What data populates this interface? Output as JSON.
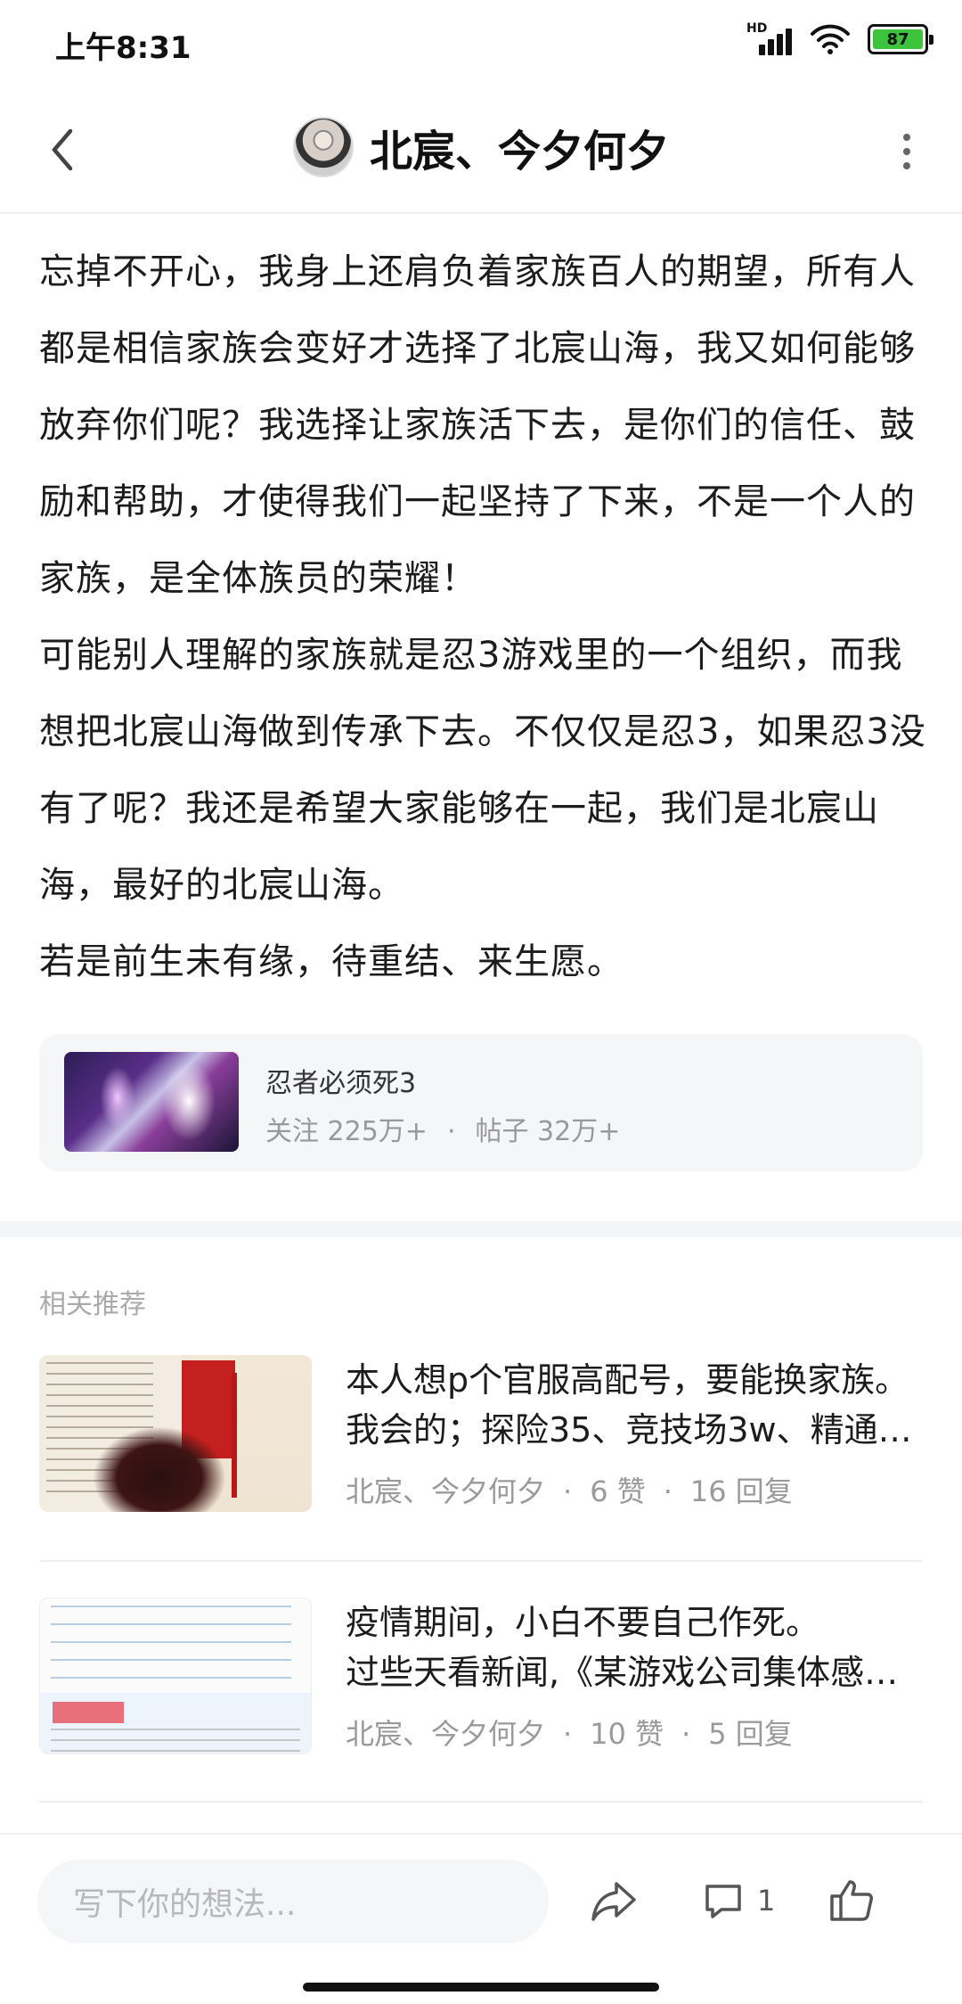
{
  "status_bar": {
    "time": "上午8:31",
    "network": "HD",
    "battery": "87"
  },
  "header": {
    "title": "北宸、今夕何夕"
  },
  "article": {
    "paragraphs": [
      "忘掉不开心，我身上还肩负着家族百人的期望，所有人都是相信家族会变好才选择了北宸山海，我又如何能够放弃你们呢？我选择让家族活下去，是你们的信任、鼓励和帮助，才使得我们一起坚持了下来，不是一个人的家族，是全体族员的荣耀！",
      "可能别人理解的家族就是忍3游戏里的一个组织，而我想把北宸山海做到传承下去。不仅仅是忍3，如果忍3没有了呢？我还是希望大家能够在一起，我们是北宸山海，最好的北宸山海。",
      "若是前生未有缘，待重结、来生愿。"
    ]
  },
  "forum_card": {
    "name": "忍者必须死3",
    "followers_label": "关注 225万+",
    "posts_label": "帖子 32万+",
    "separator": "·"
  },
  "related": {
    "label": "相关推荐",
    "items": [
      {
        "line1": "本人想p个官服高配号，要能换家族。",
        "line2": "我会的；探险35、竞技场3w、精通…",
        "author": "北宸、今夕何夕",
        "likes": "6 赞",
        "replies": "16 回复"
      },
      {
        "line1": "疫情期间，小白不要自己作死。",
        "line2": "过些天看新闻,《某游戏公司集体感…",
        "author": "北宸、今夕何夕",
        "likes": "10 赞",
        "replies": "5 回复"
      }
    ],
    "separator": "·"
  },
  "bottom_bar": {
    "placeholder": "写下你的想法...",
    "comment_count": "1"
  },
  "icons": {
    "back": "chevron-left-icon",
    "more": "more-vertical-icon",
    "share": "share-icon",
    "comment": "comment-icon",
    "like": "thumbs-up-icon"
  },
  "colors": {
    "battery_fill": "#3cc43c",
    "card_bg": "#f5f6f8",
    "muted_text": "#999999"
  }
}
